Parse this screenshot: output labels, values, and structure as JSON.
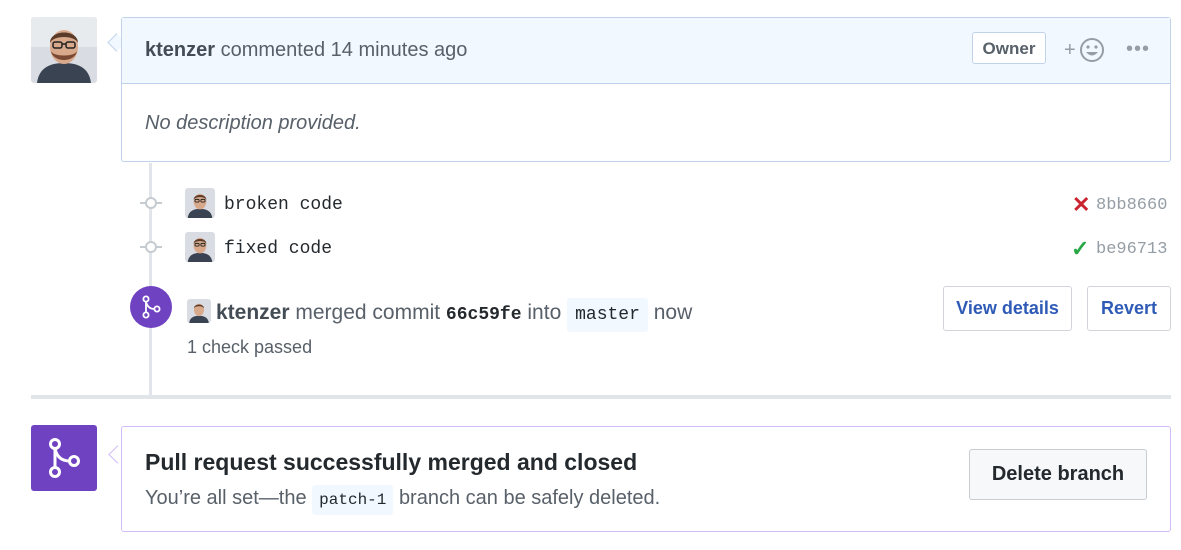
{
  "comment": {
    "author": "ktenzer",
    "action": "commented",
    "time": "14 minutes ago",
    "role_badge": "Owner",
    "reaction_plus": "+",
    "more_menu": "•••",
    "body": "No description provided."
  },
  "commits": [
    {
      "message": "broken code",
      "status": "failure",
      "status_glyph": "✕",
      "sha": "8bb8660"
    },
    {
      "message": "fixed code",
      "status": "success",
      "status_glyph": "✓",
      "sha": "be96713"
    }
  ],
  "merge_event": {
    "author": "ktenzer",
    "text_merged": "merged commit",
    "commit_sha": "66c59fe",
    "text_into": "into",
    "branch": "master",
    "time": "now",
    "checks": "1 check passed",
    "view_details_label": "View details",
    "revert_label": "Revert"
  },
  "merged_panel": {
    "title": "Pull request successfully merged and closed",
    "sub_prefix": "You’re all set—the",
    "branch": "patch-1",
    "sub_suffix": "branch can be safely deleted.",
    "delete_label": "Delete branch"
  },
  "colors": {
    "merge_purple": "#6f42c1",
    "failure_red": "#cb2431",
    "success_green": "#28a745",
    "link_blue": "#2f5bb7"
  }
}
